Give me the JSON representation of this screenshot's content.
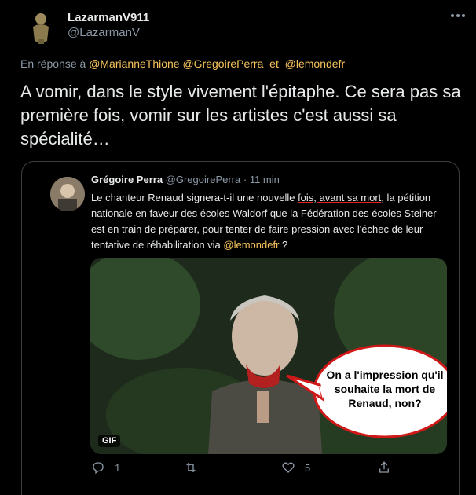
{
  "tweet": {
    "display_name": "LazarmanV911",
    "handle": "@LazarmanV",
    "reply_prefix": "En réponse à",
    "reply_mentions": [
      "@MarianneThione",
      "@GregoirePerra",
      "et",
      "@lemondefr"
    ],
    "text": "A vomir, dans le style vivement l'épitaphe. Ce sera pas sa première fois, vomir sur les artistes c'est aussi sa spécialité…"
  },
  "quoted": {
    "name": "Grégoire Perra",
    "handle": "@GregoirePerra",
    "time": "· 11 min",
    "text_part1": "Le chanteur Renaud signera-t-il une nouvelle ",
    "text_underlined": "fois, avant sa mort",
    "text_part2": ", la pétition nationale en faveur des écoles Waldorf que la Fédération des écoles Steiner est en train de préparer, pour tenter de faire pression avec l'échec de leur tentative de réhabilitation via ",
    "mention": "@lemondefr",
    "text_end": " ?",
    "media": {
      "badge": "GIF",
      "bubble_text": "On a l'impression qu'il souhaite la mort de Renaud, non?"
    },
    "actions": {
      "reply_count": "1",
      "retweet_count": "",
      "like_count": "5"
    }
  },
  "colors": {
    "background": "#000000",
    "text": "#e7e9ea",
    "muted": "#8b98a5",
    "mention": "#f7c35c",
    "border": "#3c4043",
    "underline": "#e02020"
  },
  "icons": [
    "more-icon",
    "reply-icon",
    "retweet-icon",
    "like-icon",
    "share-icon"
  ]
}
